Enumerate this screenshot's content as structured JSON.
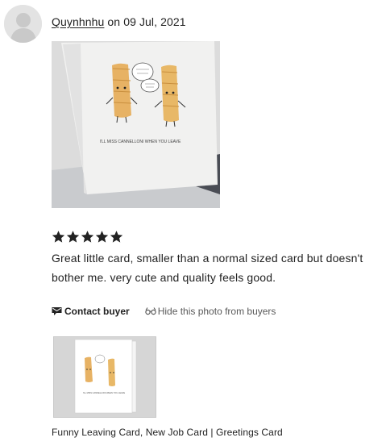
{
  "review": {
    "username": "Quynhnhu",
    "date_prefix": " on ",
    "date": "09 Jul, 2021",
    "rating": 5,
    "rating_max": 5,
    "text": "Great little card, smaller than a normal sized card but doesn't bother me. very cute and quality feels good.",
    "photo_card_caption": "I'LL MISS CANNELLONI WHEN YOU LEAVE"
  },
  "actions": {
    "contact_label": "Contact buyer",
    "hide_label": "Hide this photo from buyers"
  },
  "product": {
    "title": "Funny Leaving Card, New Job Card | Greetings Card",
    "thumb_caption": "I'LL MISS CANNELLONI WHEN YOU LEAVE"
  },
  "colors": {
    "star": "#222222",
    "text": "#222222",
    "muted": "#595959",
    "avatar_bg": "#e3e3e3"
  },
  "icons": {
    "contact": "envelope-icon",
    "hide": "hide-eye-icon",
    "star": "star-icon"
  }
}
